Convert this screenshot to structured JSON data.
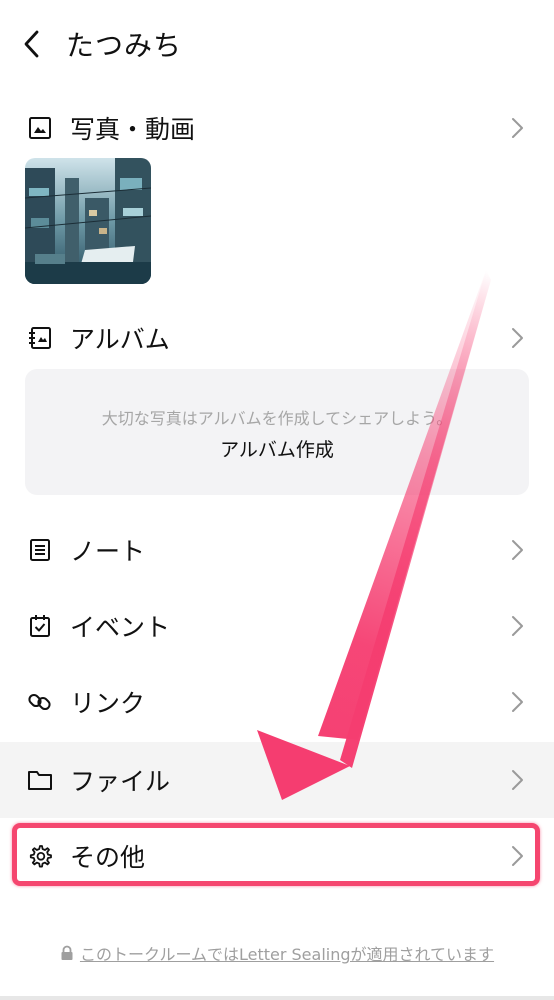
{
  "header": {
    "title": "たつみち",
    "back_icon": "chevron-left-icon"
  },
  "menu": {
    "photos": {
      "label": "写真・動画",
      "icon": "photo-icon"
    },
    "album": {
      "label": "アルバム",
      "icon": "album-icon"
    },
    "note": {
      "label": "ノート",
      "icon": "note-icon"
    },
    "event": {
      "label": "イベント",
      "icon": "calendar-icon"
    },
    "link": {
      "label": "リンク",
      "icon": "link-icon"
    },
    "file": {
      "label": "ファイル",
      "icon": "folder-icon"
    },
    "other": {
      "label": "その他",
      "icon": "gear-icon"
    }
  },
  "album_box": {
    "hint": "大切な写真はアルバムを作成してシェアしよう。",
    "create_label": "アルバム作成"
  },
  "footer": {
    "text": "このトークルームではLetter Sealingが適用されています",
    "icon": "lock-icon"
  },
  "colors": {
    "highlight": "#f5466f",
    "arrow": "#f53d70"
  }
}
